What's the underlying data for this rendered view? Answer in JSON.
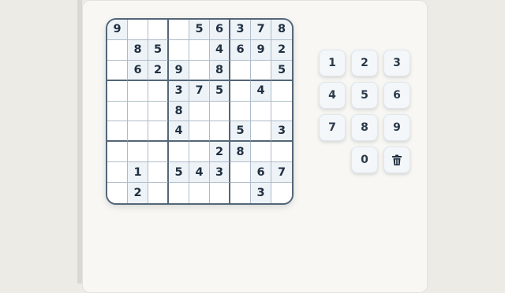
{
  "board": {
    "rows": [
      [
        "9",
        "",
        "",
        "",
        "5",
        "6",
        "3",
        "7",
        "8"
      ],
      [
        "",
        "8",
        "5",
        "",
        "",
        "4",
        "6",
        "9",
        "2"
      ],
      [
        "",
        "6",
        "2",
        "9",
        "",
        "8",
        "",
        "",
        "5"
      ],
      [
        "",
        "",
        "",
        "3",
        "7",
        "5",
        "",
        "4",
        ""
      ],
      [
        "",
        "",
        "",
        "8",
        "",
        "",
        "",
        "",
        ""
      ],
      [
        "",
        "",
        "",
        "4",
        "",
        "",
        "5",
        "",
        "3"
      ],
      [
        "",
        "",
        "",
        "",
        "",
        "2",
        "8",
        "",
        ""
      ],
      [
        "",
        "1",
        "",
        "5",
        "4",
        "3",
        "",
        "6",
        "7"
      ],
      [
        "",
        "2",
        "",
        "",
        "",
        "",
        "",
        "3",
        ""
      ]
    ]
  },
  "numpad": {
    "keys": [
      "1",
      "2",
      "3",
      "4",
      "5",
      "6",
      "7",
      "8",
      "9",
      "0"
    ],
    "erase_icon": "trash-icon"
  },
  "colors": {
    "grid_line_thick": "#546678",
    "grid_line_thin": "#aebbc8",
    "digit": "#1f2f3f",
    "cell_shade": "#eef3f8",
    "key_bg": "#f4f7fa",
    "panel_bg": "#f8f7f3"
  }
}
